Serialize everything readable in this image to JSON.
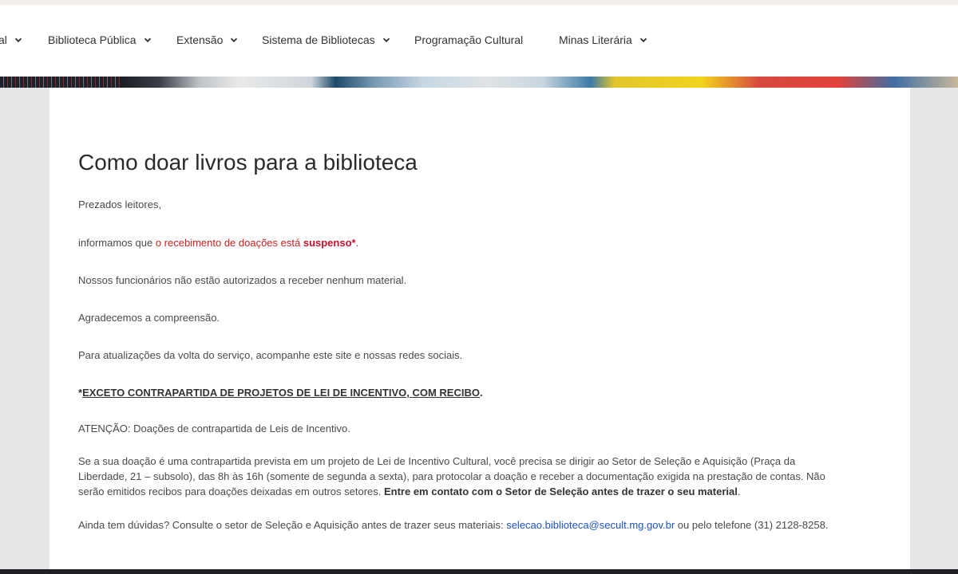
{
  "nav": {
    "items": [
      {
        "label": "al",
        "has_dropdown": true
      },
      {
        "label": "Biblioteca Pública",
        "has_dropdown": true
      },
      {
        "label": "Extensão",
        "has_dropdown": true
      },
      {
        "label": "Sistema de Bibliotecas",
        "has_dropdown": true
      },
      {
        "label": "Programação Cultural",
        "has_dropdown": false
      },
      {
        "label": "Minas Literária",
        "has_dropdown": true
      }
    ],
    "dropdown_icon": "chevron-down-icon"
  },
  "article": {
    "title": "Como doar livros para a biblioteca",
    "greeting": "Prezados leitores,",
    "notice": {
      "prefix": "informamos que ",
      "red_text": "o recebimento de doações está ",
      "bold_red": "suspenso*",
      "suffix": "."
    },
    "staff_notice": "Nossos funcionários não estão autorizados a receber nenhum material.",
    "thanks": "Agradecemos a compreensão.",
    "updates": "Para atualizações da volta do serviço, acompanhe este site e nossas redes sociais.",
    "exception": {
      "star": "*",
      "text": "EXCETO CONTRAPARTIDA DE PROJETOS DE LEI DE INCENTIVO, COM RECIBO",
      "end": "."
    },
    "attention": "ATENÇÃO: Doações de contrapartida de Leis de Incentivo.",
    "incentive": {
      "line1": "Se a sua doação é uma contrapartida prevista em um projeto de Lei de Incentivo Cultural, você precisa se dirigir ao Setor de Seleção e Aquisição (Praça da",
      "line2": "Liberdade, 21 – subsolo), das 8h às 16h (somente de segunda a sexta), para protocolar a doação e receber a documentação exigida na prestação de contas. Não",
      "line3_prefix": "serão emitidos recibos para doações deixadas em outros setores. ",
      "line3_bold": "Entre em contato com o Setor de Seleção antes de trazer o seu material",
      "line3_end": "."
    },
    "contact": {
      "prefix": "Ainda tem dúvidas? Consulte o setor de Seleção e Aquisição antes de trazer seus materiais: ",
      "email": "selecao.biblioteca@secult.mg.gov.br",
      "suffix": " ou  pelo telefone (31) 2128-8258."
    }
  },
  "colors": {
    "notice_red": "#d32020",
    "link_blue": "#1a53c8",
    "background": "#e6e6e6"
  }
}
